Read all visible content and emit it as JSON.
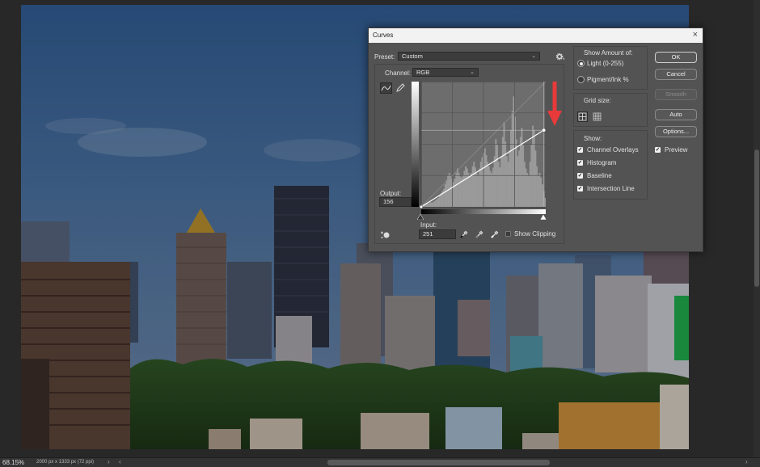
{
  "status_bar": {
    "zoom": "68.15%",
    "doc_info": "2000 px x 1333 px (72 ppi)",
    "nav_arrow": "›",
    "scroll_left": "‹",
    "scroll_right": "›"
  },
  "dialog": {
    "title": "Curves",
    "close_glyph": "×",
    "preset_label": "Preset:",
    "preset_value": "Custom",
    "channel_label": "Channel:",
    "channel_value": "RGB",
    "output_label": "Output:",
    "output_value": "156",
    "input_label": "Input:",
    "input_value": "251",
    "show_clipping_label": "Show Clipping",
    "show_clipping_checked": false,
    "show_amount": {
      "title": "Show Amount of:",
      "options": [
        {
          "label": "Light  (0-255)",
          "selected": true
        },
        {
          "label": "Pigment/Ink %",
          "selected": false
        }
      ]
    },
    "grid_size_label": "Grid size:",
    "show": {
      "title": "Show:",
      "options": [
        {
          "label": "Channel Overlays",
          "checked": true
        },
        {
          "label": "Histogram",
          "checked": true
        },
        {
          "label": "Baseline",
          "checked": true
        },
        {
          "label": "Intersection Line",
          "checked": true
        }
      ]
    },
    "buttons": {
      "ok": "OK",
      "cancel": "Cancel",
      "smooth": "Smooth",
      "auto": "Auto",
      "options": "Options..."
    },
    "preview_label": "Preview",
    "preview_checked": true,
    "curve": {
      "points": [
        [
          0,
          0
        ],
        [
          251,
          156
        ]
      ],
      "range": [
        0,
        255
      ]
    },
    "histogram": [
      2,
      2,
      2,
      3,
      3,
      3,
      4,
      4,
      4,
      5,
      6,
      7,
      8,
      10,
      12,
      14,
      16,
      20,
      24,
      28,
      30,
      28,
      25,
      22,
      25,
      30,
      34,
      30,
      27,
      26,
      28,
      32,
      36,
      34,
      30,
      28,
      30,
      36,
      40,
      35,
      30,
      28,
      34,
      40,
      44,
      48,
      52,
      46,
      40,
      36,
      32,
      30,
      35,
      45,
      60,
      55,
      40,
      35,
      45,
      62,
      75,
      58,
      45,
      40,
      50,
      68,
      85,
      98,
      80,
      60,
      45,
      50,
      62,
      70,
      55,
      40,
      34,
      30,
      28,
      40,
      55,
      72,
      68,
      50,
      36,
      28,
      30,
      26,
      20,
      14,
      8
    ]
  },
  "colors": {
    "annotation_arrow": "#e83a3a",
    "dialog_bg": "#535353",
    "titlebar_bg": "#f2f2f2"
  },
  "icons": [
    "curve-tool-icon",
    "pencil-icon",
    "hand-adjust-icon",
    "eyedropper-black-icon",
    "eyedropper-gray-icon",
    "eyedropper-white-icon",
    "gear-icon",
    "grid-small-icon",
    "grid-large-icon",
    "red-arrow-icon"
  ]
}
